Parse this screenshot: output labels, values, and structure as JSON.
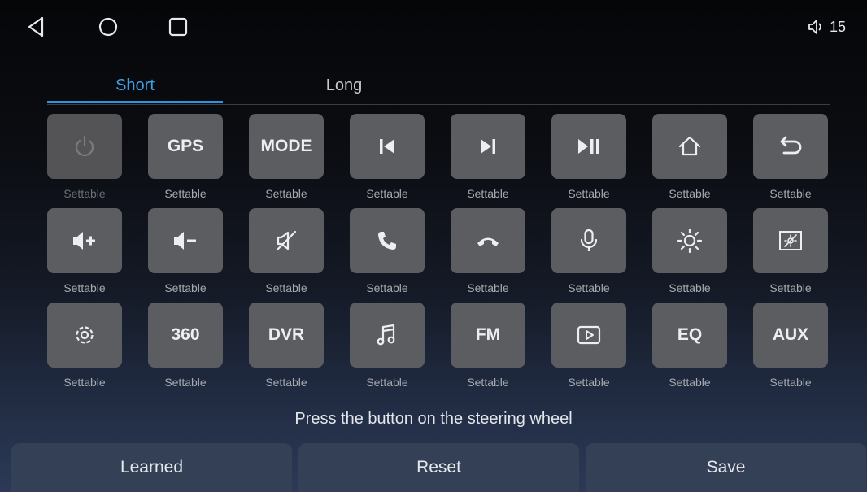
{
  "colors": {
    "accent": "#2f92e0",
    "key_bg": "#5c5d60",
    "bottom_button_bg": "#344056"
  },
  "statusbar": {
    "back_icon": "back-triangle-icon",
    "home_icon": "home-circle-icon",
    "recent_icon": "recent-square-icon",
    "volume_icon": "speaker-icon",
    "volume_level": "15"
  },
  "tabs": [
    {
      "label": "Short",
      "active": true
    },
    {
      "label": "Long",
      "active": false
    }
  ],
  "keys": [
    {
      "icon": "power-icon",
      "text": "",
      "status": "Settable",
      "dim": true
    },
    {
      "icon": "",
      "text": "GPS",
      "status": "Settable"
    },
    {
      "icon": "",
      "text": "MODE",
      "status": "Settable"
    },
    {
      "icon": "previous-track-icon",
      "text": "",
      "status": "Settable"
    },
    {
      "icon": "next-track-icon",
      "text": "",
      "status": "Settable"
    },
    {
      "icon": "play-pause-icon",
      "text": "",
      "status": "Settable"
    },
    {
      "icon": "home-icon",
      "text": "",
      "status": "Settable"
    },
    {
      "icon": "return-icon",
      "text": "",
      "status": "Settable"
    },
    {
      "icon": "volume-up-icon",
      "text": "",
      "status": "Settable"
    },
    {
      "icon": "volume-down-icon",
      "text": "",
      "status": "Settable"
    },
    {
      "icon": "mute-icon",
      "text": "",
      "status": "Settable"
    },
    {
      "icon": "phone-answer-icon",
      "text": "",
      "status": "Settable"
    },
    {
      "icon": "phone-hangup-icon",
      "text": "",
      "status": "Settable"
    },
    {
      "icon": "microphone-icon",
      "text": "",
      "status": "Settable"
    },
    {
      "icon": "brightness-icon",
      "text": "",
      "status": "Settable"
    },
    {
      "icon": "screen-off-icon",
      "text": "",
      "status": "Settable"
    },
    {
      "icon": "settings-gear-icon",
      "text": "",
      "status": "Settable"
    },
    {
      "icon": "",
      "text": "360",
      "status": "Settable"
    },
    {
      "icon": "",
      "text": "DVR",
      "status": "Settable"
    },
    {
      "icon": "music-note-icon",
      "text": "",
      "status": "Settable"
    },
    {
      "icon": "",
      "text": "FM",
      "status": "Settable"
    },
    {
      "icon": "video-play-icon",
      "text": "",
      "status": "Settable"
    },
    {
      "icon": "",
      "text": "EQ",
      "status": "Settable"
    },
    {
      "icon": "",
      "text": "AUX",
      "status": "Settable"
    }
  ],
  "hint": "Press the button on the steering wheel",
  "buttons": {
    "learned": "Learned",
    "reset": "Reset",
    "save": "Save"
  }
}
